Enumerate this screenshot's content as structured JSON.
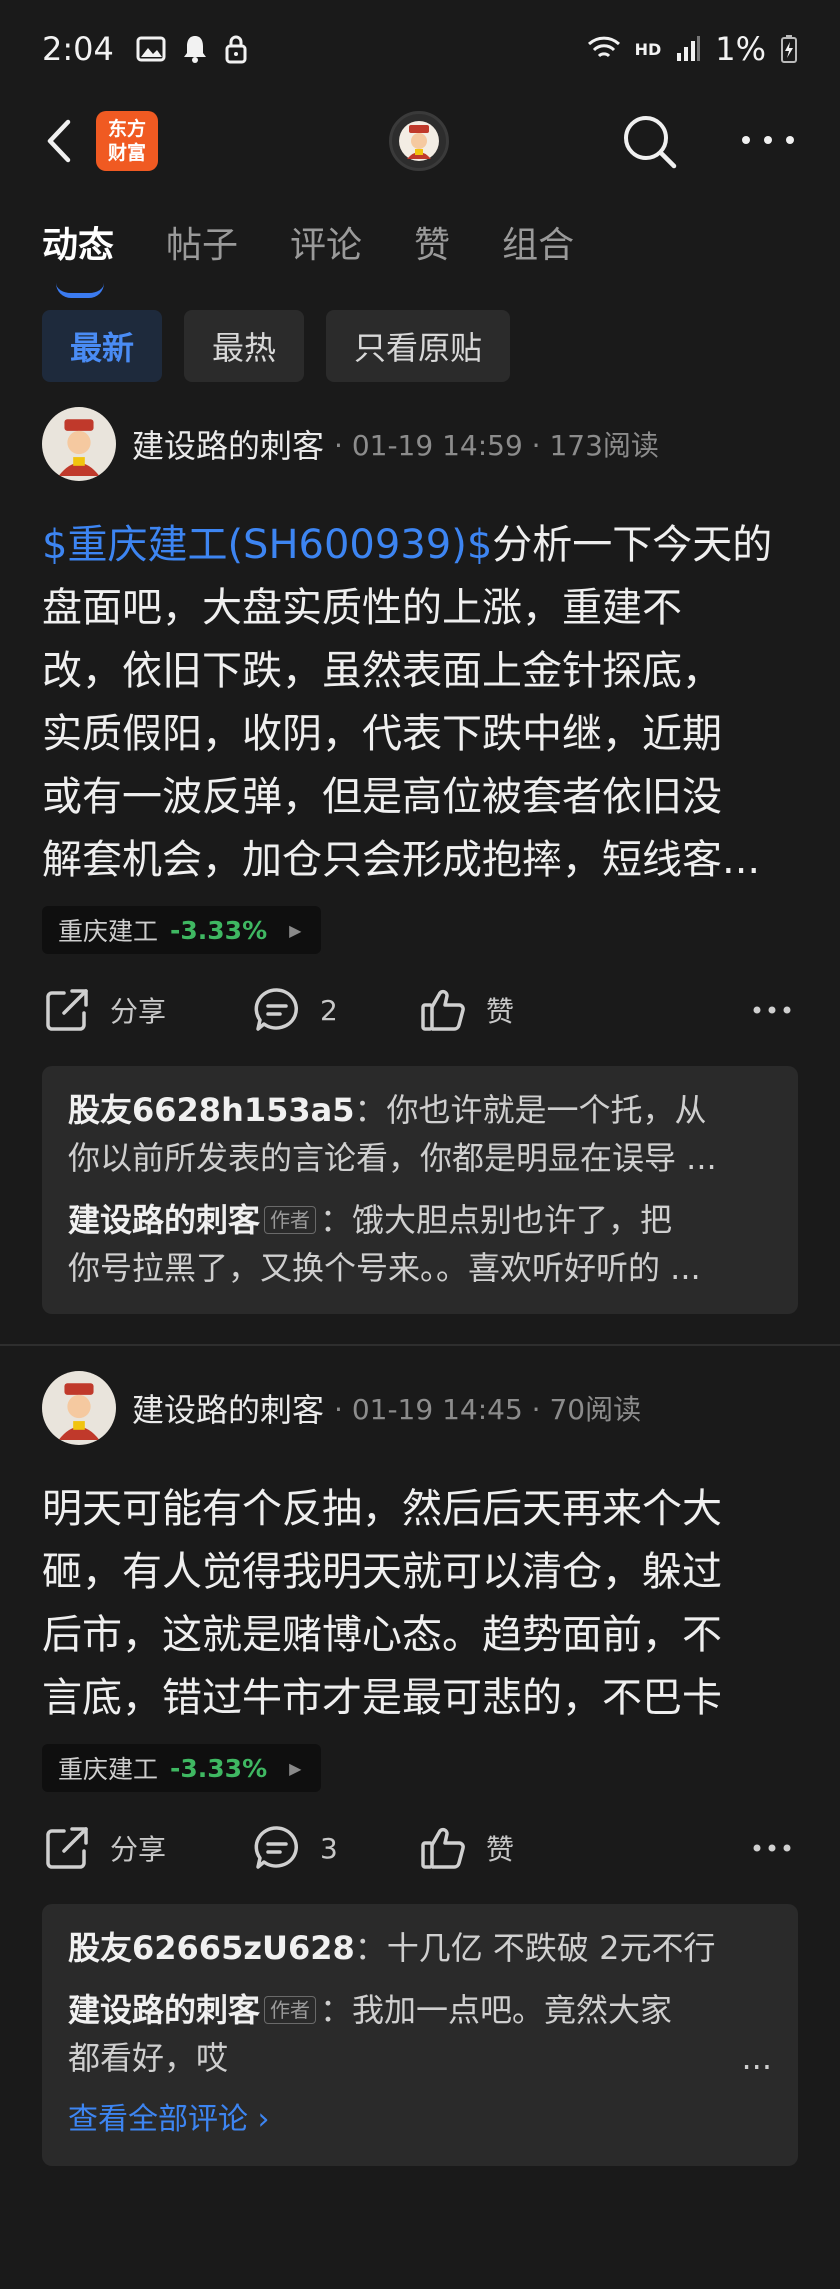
{
  "status": {
    "time": "2:04",
    "hd": "HD",
    "battery": "1%"
  },
  "nav": {
    "logo_line1": "东方",
    "logo_line2": "财富"
  },
  "tabs": [
    {
      "label": "动态"
    },
    {
      "label": "帖子"
    },
    {
      "label": "评论"
    },
    {
      "label": "赞"
    },
    {
      "label": "组合"
    }
  ],
  "filters": [
    {
      "label": "最新"
    },
    {
      "label": "最热"
    },
    {
      "label": "只看原贴"
    }
  ],
  "posts": [
    {
      "author": "建设路的刺客",
      "meta": "· 01-19 14:59 · 173阅读",
      "stock_link": "$重庆建工(SH600939)$",
      "body_lines": [
        "分析一下今天的",
        "盘面吧，大盘实质性的上涨，重建不",
        "改，依旧下跌，虽然表面上金针探底，",
        "实质假阳，收阴，代表下跌中继，近期",
        "或有一波反弹，但是高位被套者依旧没",
        "解套机会，加仓只会形成抱摔，短线客..."
      ],
      "tag": {
        "name": "重庆建工",
        "change": "-3.33%"
      },
      "actions": {
        "share": "分享",
        "comments": "2",
        "like": "赞"
      },
      "comments": [
        {
          "who": "股友6628h153a5",
          "is_author": false,
          "line1": "：你也许就是一个托，从",
          "line2": "你以前所发表的言论看，你都是明显在误导 ..."
        },
        {
          "who": "建设路的刺客",
          "is_author": true,
          "badge": "作者",
          "line1": "：饿大胆点别也许了，把",
          "line2": "你号拉黑了，又换个号来。。喜欢听好听的 ..."
        }
      ]
    },
    {
      "author": "建设路的刺客",
      "meta": "· 01-19 14:45 · 70阅读",
      "body_lines": [
        "明天可能有个反抽，然后后天再来个大",
        "砸，有人觉得我明天就可以清仓，躲过",
        "后市，这就是赌博心态。趋势面前，不",
        "言底，错过牛市才是最可悲的，不巴卡"
      ],
      "tag": {
        "name": "重庆建工",
        "change": "-3.33%"
      },
      "actions": {
        "share": "分享",
        "comments": "3",
        "like": "赞"
      },
      "comments": [
        {
          "who": "股友62665zU628",
          "is_author": false,
          "line1": "：十几亿 不跌破  2元不行"
        },
        {
          "who": "建设路的刺客",
          "is_author": true,
          "badge": "作者",
          "line1": "：我加一点吧。竟然大家",
          "line2": "都看好，哎",
          "trail": "..."
        }
      ],
      "view_all": "查看全部评论 ›"
    }
  ],
  "colors": {
    "accent": "#3d85f2",
    "down": "#3fb862",
    "logo": "#f05a22",
    "background": "#1a1a1a"
  }
}
